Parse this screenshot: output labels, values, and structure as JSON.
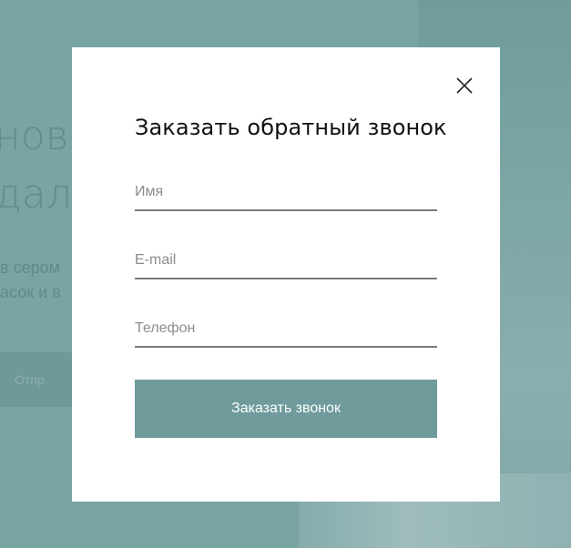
{
  "background": {
    "heading_line1": "нов",
    "heading_line2": "дал",
    "text_line1": "в сером",
    "text_line2": "асок и в",
    "button_label": "Отпр"
  },
  "modal": {
    "title": "Заказать обратный звонок",
    "close_icon": "close-icon",
    "fields": {
      "name_placeholder": "Имя",
      "email_placeholder": "E-mail",
      "phone_placeholder": "Телефон"
    },
    "submit_label": "Заказать звонок"
  },
  "colors": {
    "backdrop": "#79a4a4",
    "accent": "#6f9b9c",
    "modal_bg": "#ffffff"
  }
}
